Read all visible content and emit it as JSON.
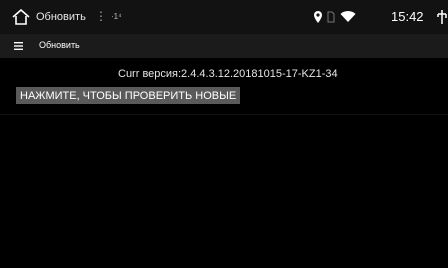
{
  "status_bar": {
    "app_title": "Обновить",
    "overflow_dots": "⋮",
    "small_badge": "·1⁴",
    "time": "15:42",
    "icons": [
      "home-icon",
      "location-icon",
      "sim-icon",
      "wifi-icon",
      "usb-icon"
    ]
  },
  "app_bar": {
    "title": "Обновить",
    "menu_icon": "menu-icon"
  },
  "main": {
    "version_text": "Curr версия:2.4.4.3.12.20181015-17-KZ1-34",
    "check_button_label": "НАЖМИТЕ, ЧТОБЫ ПРОВЕРИТЬ НОВЫЕ"
  },
  "colors": {
    "background": "#000000",
    "status_bar": "#121212",
    "app_bar": "#1b1b1b",
    "button": "#5a5a5a"
  }
}
